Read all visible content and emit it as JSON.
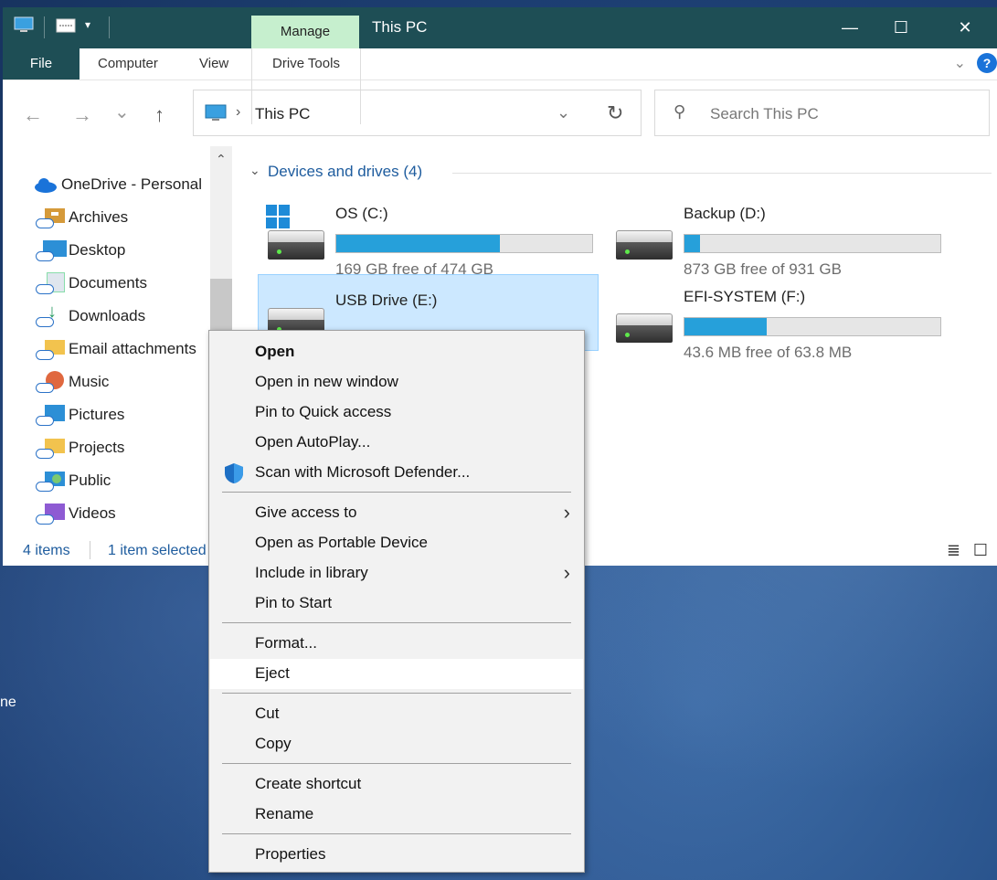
{
  "window": {
    "title": "This PC",
    "manage_tab": "Manage",
    "ribbon": {
      "file": "File",
      "computer": "Computer",
      "view": "View",
      "drive_tools": "Drive Tools",
      "help": "?"
    },
    "controls": {
      "minimize": "—",
      "maximize": "☐",
      "close": "✕"
    }
  },
  "nav": {
    "back": "←",
    "forward": "→",
    "recent": "⌄",
    "up": "↑",
    "breadcrumb_sep": "›",
    "location": "This PC",
    "dropdown": "⌄",
    "refresh": "↻"
  },
  "search": {
    "placeholder": "Search This PC",
    "icon": "⚲"
  },
  "sidebar": {
    "items": [
      {
        "label": "OneDrive - Personal",
        "icon": "onedrive-cloud-icon"
      },
      {
        "label": "Archives",
        "icon": "folder-archive-icon"
      },
      {
        "label": "Desktop",
        "icon": "desktop-folder-icon"
      },
      {
        "label": "Documents",
        "icon": "documents-folder-icon"
      },
      {
        "label": "Downloads",
        "icon": "downloads-folder-icon"
      },
      {
        "label": "Email attachments",
        "icon": "email-attachments-folder-icon"
      },
      {
        "label": "Music",
        "icon": "music-folder-icon"
      },
      {
        "label": "Pictures",
        "icon": "pictures-folder-icon"
      },
      {
        "label": "Projects",
        "icon": "projects-folder-icon"
      },
      {
        "label": "Public",
        "icon": "public-folder-icon"
      },
      {
        "label": "Videos",
        "icon": "videos-folder-icon"
      }
    ],
    "scroll_up": "⌃"
  },
  "content": {
    "group_title": "Devices and drives (4)",
    "group_chevron": "⌄",
    "drives": [
      {
        "name": "OS (C:)",
        "free_text": "169 GB free of 474 GB",
        "used_fraction": 0.64
      },
      {
        "name": "Backup (D:)",
        "free_text": "873 GB free of 931 GB",
        "used_fraction": 0.06
      },
      {
        "name": "USB Drive (E:)",
        "free_text": "",
        "used_fraction": null
      },
      {
        "name": "EFI-SYSTEM (F:)",
        "free_text": "43.6 MB free of 63.8 MB",
        "used_fraction": 0.32
      }
    ]
  },
  "status": {
    "item_count": "4 items",
    "selection": "1 item selected",
    "details_view": "≣",
    "tiles_view": "☐"
  },
  "context_menu": {
    "items": [
      {
        "label": "Open"
      },
      {
        "label": "Open in new window"
      },
      {
        "label": "Pin to Quick access"
      },
      {
        "label": "Open AutoPlay..."
      },
      {
        "label": "Scan with Microsoft Defender..."
      },
      {
        "label": "Give access to",
        "submenu_arrow": "›"
      },
      {
        "label": "Open as Portable Device"
      },
      {
        "label": "Include in library",
        "submenu_arrow": "›"
      },
      {
        "label": "Pin to Start"
      },
      {
        "label": "Format..."
      },
      {
        "label": "Eject"
      },
      {
        "label": "Cut"
      },
      {
        "label": "Copy"
      },
      {
        "label": "Create shortcut"
      },
      {
        "label": "Rename"
      },
      {
        "label": "Properties"
      }
    ]
  },
  "desktop": {
    "edge_label": "ne"
  },
  "colors": {
    "titlebar": "#1e4e55",
    "manage_tab": "#c6efce",
    "progress": "#26a0da",
    "selection": "#cce8ff",
    "accent_text": "#1e5c9e"
  }
}
